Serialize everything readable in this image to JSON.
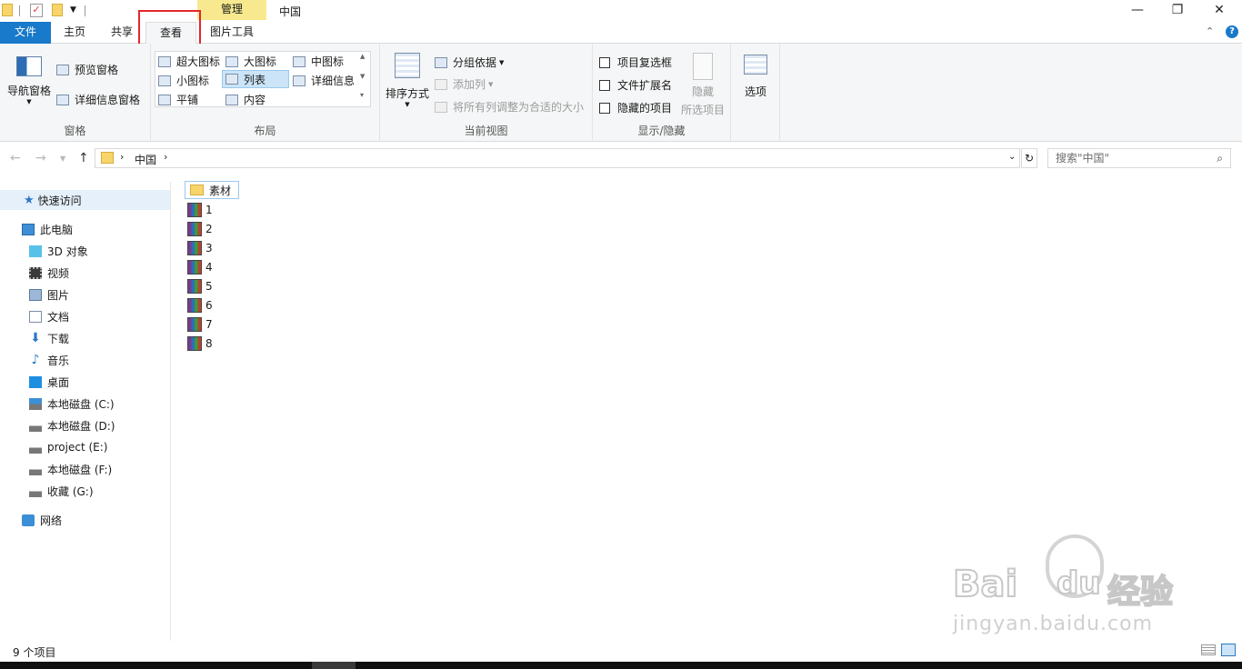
{
  "titlebar": {
    "context_tab": "管理",
    "window_title": "中国",
    "minimize": "—",
    "restore": "❐",
    "close": "✕"
  },
  "tabs": [
    "文件",
    "主页",
    "共享",
    "查看",
    "图片工具"
  ],
  "active_tab": "查看",
  "help_icon": "?",
  "ribbon": {
    "pane_group": {
      "label": "窗格",
      "nav_pane": "导航窗格",
      "preview_pane": "预览窗格",
      "details_pane": "详细信息窗格"
    },
    "layout_group": {
      "label": "布局",
      "items": [
        "超大图标",
        "大图标",
        "中图标",
        "小图标",
        "列表",
        "详细信息",
        "平铺",
        "内容"
      ],
      "selected": "列表"
    },
    "current_view_group": {
      "label": "当前视图",
      "sort_by": "排序方式",
      "group_by": "分组依据",
      "add_column": "添加列",
      "fit_columns": "将所有列调整为合适的大小"
    },
    "show_hide_group": {
      "label": "显示/隐藏",
      "item_checkboxes": "项目复选框",
      "file_extensions": "文件扩展名",
      "hidden_items": "隐藏的项目",
      "hide_selected_1": "隐藏",
      "hide_selected_2": "所选项目"
    },
    "options": "选项"
  },
  "address": {
    "crumb": "中国",
    "search_placeholder": "搜索\"中国\""
  },
  "sidebar": {
    "quick_access": "快速访问",
    "this_pc": "此电脑",
    "items": [
      "3D 对象",
      "视频",
      "图片",
      "文档",
      "下载",
      "音乐",
      "桌面",
      "本地磁盘 (C:)",
      "本地磁盘 (D:)",
      "project (E:)",
      "本地磁盘 (F:)",
      "收藏 (G:)"
    ],
    "network": "网络"
  },
  "files": {
    "folder": "素材",
    "archives": [
      "1",
      "2",
      "3",
      "4",
      "5",
      "6",
      "7",
      "8"
    ]
  },
  "status": {
    "count": "9 个项目"
  },
  "watermark": {
    "brand_latin": "Bai",
    "brand_latin_2": "du",
    "brand_cn": "经验",
    "url": "jingyan.baidu.com"
  }
}
